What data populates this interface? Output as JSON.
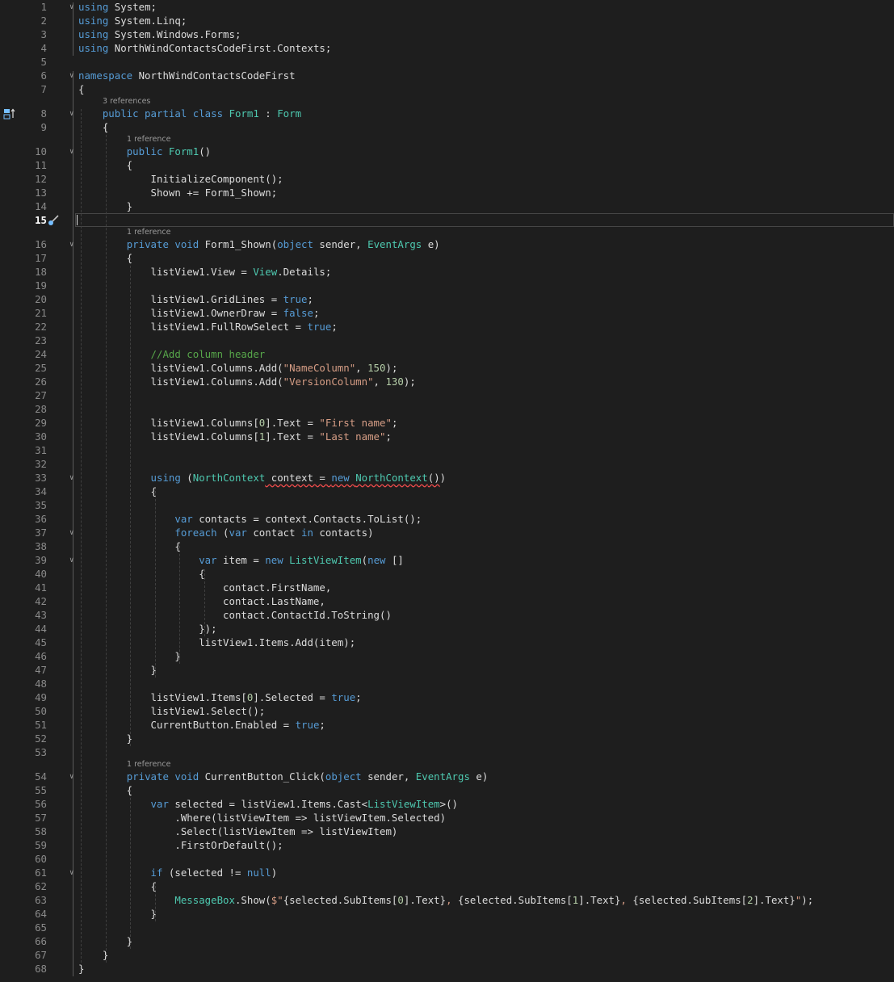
{
  "editor": {
    "lines": [
      {
        "n": "1",
        "toks": [
          [
            "kw",
            "using"
          ],
          [
            "pl",
            " System;"
          ]
        ]
      },
      {
        "n": "2",
        "toks": [
          [
            "kw",
            "using"
          ],
          [
            "pl",
            " System.Linq;"
          ]
        ]
      },
      {
        "n": "3",
        "toks": [
          [
            "kw",
            "using"
          ],
          [
            "pl",
            " System.Windows.Forms;"
          ]
        ]
      },
      {
        "n": "4",
        "toks": [
          [
            "kw",
            "using"
          ],
          [
            "pl",
            " NorthWindContactsCodeFirst.Contexts;"
          ]
        ]
      },
      {
        "n": "5",
        "toks": []
      },
      {
        "n": "6",
        "toks": [
          [
            "kw",
            "namespace"
          ],
          [
            "pl",
            " NorthWindContactsCodeFirst"
          ]
        ]
      },
      {
        "n": "7",
        "toks": [
          [
            "pl",
            "{"
          ]
        ]
      },
      {
        "n": "8",
        "toks": [
          [
            "pl",
            "    "
          ],
          [
            "kw",
            "public partial class "
          ],
          [
            "ty",
            "Form1"
          ],
          [
            "pl",
            " : "
          ],
          [
            "ty",
            "Form"
          ]
        ]
      },
      {
        "n": "9",
        "toks": [
          [
            "pl",
            "    {"
          ]
        ]
      },
      {
        "n": "10",
        "toks": [
          [
            "pl",
            "        "
          ],
          [
            "kw",
            "public "
          ],
          [
            "ty",
            "Form1"
          ],
          [
            "pl",
            "()"
          ]
        ]
      },
      {
        "n": "11",
        "toks": [
          [
            "pl",
            "        {"
          ]
        ]
      },
      {
        "n": "12",
        "toks": [
          [
            "pl",
            "            InitializeComponent();"
          ]
        ]
      },
      {
        "n": "13",
        "toks": [
          [
            "pl",
            "            Shown += Form1_Shown;"
          ]
        ]
      },
      {
        "n": "14",
        "toks": [
          [
            "pl",
            "        }"
          ]
        ]
      },
      {
        "n": "15",
        "toks": []
      },
      {
        "n": "16",
        "toks": [
          [
            "pl",
            "        "
          ],
          [
            "kw",
            "private void "
          ],
          [
            "pl",
            "Form1_Shown("
          ],
          [
            "kw",
            "object"
          ],
          [
            "pl",
            " sender, "
          ],
          [
            "ty",
            "EventArgs"
          ],
          [
            "pl",
            " e)"
          ]
        ]
      },
      {
        "n": "17",
        "toks": [
          [
            "pl",
            "        {"
          ]
        ]
      },
      {
        "n": "18",
        "toks": [
          [
            "pl",
            "            listView1.View = "
          ],
          [
            "ty",
            "View"
          ],
          [
            "pl",
            ".Details;"
          ]
        ]
      },
      {
        "n": "19",
        "toks": []
      },
      {
        "n": "20",
        "toks": [
          [
            "pl",
            "            listView1.GridLines = "
          ],
          [
            "kw",
            "true"
          ],
          [
            "pl",
            ";"
          ]
        ]
      },
      {
        "n": "21",
        "toks": [
          [
            "pl",
            "            listView1.OwnerDraw = "
          ],
          [
            "kw",
            "false"
          ],
          [
            "pl",
            ";"
          ]
        ]
      },
      {
        "n": "22",
        "toks": [
          [
            "pl",
            "            listView1.FullRowSelect = "
          ],
          [
            "kw",
            "true"
          ],
          [
            "pl",
            ";"
          ]
        ]
      },
      {
        "n": "23",
        "toks": []
      },
      {
        "n": "24",
        "toks": [
          [
            "pl",
            "            "
          ],
          [
            "cm",
            "//Add column header"
          ]
        ]
      },
      {
        "n": "25",
        "toks": [
          [
            "pl",
            "            listView1.Columns.Add("
          ],
          [
            "str",
            "\"NameColumn\""
          ],
          [
            "pl",
            ", "
          ],
          [
            "num",
            "150"
          ],
          [
            "pl",
            ");"
          ]
        ]
      },
      {
        "n": "26",
        "toks": [
          [
            "pl",
            "            listView1.Columns.Add("
          ],
          [
            "str",
            "\"VersionColumn\""
          ],
          [
            "pl",
            ", "
          ],
          [
            "num",
            "130"
          ],
          [
            "pl",
            ");"
          ]
        ]
      },
      {
        "n": "27",
        "toks": []
      },
      {
        "n": "28",
        "toks": []
      },
      {
        "n": "29",
        "toks": [
          [
            "pl",
            "            listView1.Columns["
          ],
          [
            "num",
            "0"
          ],
          [
            "pl",
            "].Text = "
          ],
          [
            "str",
            "\"First name\""
          ],
          [
            "pl",
            ";"
          ]
        ]
      },
      {
        "n": "30",
        "toks": [
          [
            "pl",
            "            listView1.Columns["
          ],
          [
            "num",
            "1"
          ],
          [
            "pl",
            "].Text = "
          ],
          [
            "str",
            "\"Last name\""
          ],
          [
            "pl",
            ";"
          ]
        ]
      },
      {
        "n": "31",
        "toks": []
      },
      {
        "n": "32",
        "toks": []
      },
      {
        "n": "33",
        "toks": [
          [
            "pl",
            "            "
          ],
          [
            "kw",
            "using"
          ],
          [
            "pl",
            " ("
          ],
          [
            "ty",
            "NorthContext"
          ],
          [
            "pl squig",
            " context = "
          ],
          [
            "kw squig",
            "new "
          ],
          [
            "ty squig",
            "NorthContext"
          ],
          [
            "pl squig",
            "()"
          ],
          [
            "pl",
            ")"
          ]
        ]
      },
      {
        "n": "34",
        "toks": [
          [
            "pl",
            "            {"
          ]
        ]
      },
      {
        "n": "35",
        "toks": []
      },
      {
        "n": "36",
        "toks": [
          [
            "pl",
            "                "
          ],
          [
            "kw",
            "var"
          ],
          [
            "pl",
            " contacts = context.Contacts.ToList();"
          ]
        ]
      },
      {
        "n": "37",
        "toks": [
          [
            "pl",
            "                "
          ],
          [
            "kw",
            "foreach"
          ],
          [
            "pl",
            " ("
          ],
          [
            "kw",
            "var"
          ],
          [
            "pl",
            " contact "
          ],
          [
            "kw",
            "in"
          ],
          [
            "pl",
            " contacts)"
          ]
        ]
      },
      {
        "n": "38",
        "toks": [
          [
            "pl",
            "                {"
          ]
        ]
      },
      {
        "n": "39",
        "toks": [
          [
            "pl",
            "                    "
          ],
          [
            "kw",
            "var"
          ],
          [
            "pl",
            " item = "
          ],
          [
            "kw",
            "new "
          ],
          [
            "ty",
            "ListViewItem"
          ],
          [
            "pl",
            "("
          ],
          [
            "kw",
            "new"
          ],
          [
            "pl",
            " []"
          ]
        ]
      },
      {
        "n": "40",
        "toks": [
          [
            "pl",
            "                    {"
          ]
        ]
      },
      {
        "n": "41",
        "toks": [
          [
            "pl",
            "                        contact.FirstName,"
          ]
        ]
      },
      {
        "n": "42",
        "toks": [
          [
            "pl",
            "                        contact.LastName,"
          ]
        ]
      },
      {
        "n": "43",
        "toks": [
          [
            "pl",
            "                        contact.ContactId.ToString()"
          ]
        ]
      },
      {
        "n": "44",
        "toks": [
          [
            "pl",
            "                    });"
          ]
        ]
      },
      {
        "n": "45",
        "toks": [
          [
            "pl",
            "                    listView1.Items.Add(item);"
          ]
        ]
      },
      {
        "n": "46",
        "toks": [
          [
            "pl",
            "                }"
          ]
        ]
      },
      {
        "n": "47",
        "toks": [
          [
            "pl",
            "            }"
          ]
        ]
      },
      {
        "n": "48",
        "toks": []
      },
      {
        "n": "49",
        "toks": [
          [
            "pl",
            "            listView1.Items["
          ],
          [
            "num",
            "0"
          ],
          [
            "pl",
            "].Selected = "
          ],
          [
            "kw",
            "true"
          ],
          [
            "pl",
            ";"
          ]
        ]
      },
      {
        "n": "50",
        "toks": [
          [
            "pl",
            "            listView1.Select();"
          ]
        ]
      },
      {
        "n": "51",
        "toks": [
          [
            "pl",
            "            CurrentButton.Enabled = "
          ],
          [
            "kw",
            "true"
          ],
          [
            "pl",
            ";"
          ]
        ]
      },
      {
        "n": "52",
        "toks": [
          [
            "pl",
            "        }"
          ]
        ]
      },
      {
        "n": "53",
        "toks": []
      },
      {
        "n": "54",
        "toks": [
          [
            "pl",
            "        "
          ],
          [
            "kw",
            "private void "
          ],
          [
            "pl",
            "CurrentButton_Click("
          ],
          [
            "kw",
            "object"
          ],
          [
            "pl",
            " sender, "
          ],
          [
            "ty",
            "EventArgs"
          ],
          [
            "pl",
            " e)"
          ]
        ]
      },
      {
        "n": "55",
        "toks": [
          [
            "pl",
            "        {"
          ]
        ]
      },
      {
        "n": "56",
        "toks": [
          [
            "pl",
            "            "
          ],
          [
            "kw",
            "var"
          ],
          [
            "pl",
            " selected = listView1.Items.Cast<"
          ],
          [
            "ty",
            "ListViewItem"
          ],
          [
            "pl",
            ">()"
          ]
        ]
      },
      {
        "n": "57",
        "toks": [
          [
            "pl",
            "                .Where(listViewItem => listViewItem.Selected)"
          ]
        ]
      },
      {
        "n": "58",
        "toks": [
          [
            "pl",
            "                .Select(listViewItem => listViewItem)"
          ]
        ]
      },
      {
        "n": "59",
        "toks": [
          [
            "pl",
            "                .FirstOrDefault();"
          ]
        ]
      },
      {
        "n": "60",
        "toks": []
      },
      {
        "n": "61",
        "toks": [
          [
            "pl",
            "            "
          ],
          [
            "kw",
            "if"
          ],
          [
            "pl",
            " (selected != "
          ],
          [
            "kw",
            "null"
          ],
          [
            "pl",
            ")"
          ]
        ]
      },
      {
        "n": "62",
        "toks": [
          [
            "pl",
            "            {"
          ]
        ]
      },
      {
        "n": "63",
        "toks": [
          [
            "pl",
            "                "
          ],
          [
            "ty",
            "MessageBox"
          ],
          [
            "pl",
            ".Show("
          ],
          [
            "str",
            "$\""
          ],
          [
            "pl",
            "{selected.SubItems["
          ],
          [
            "num",
            "0"
          ],
          [
            "pl",
            "].Text}"
          ],
          [
            "str",
            ", "
          ],
          [
            "pl",
            "{selected.SubItems["
          ],
          [
            "num",
            "1"
          ],
          [
            "pl",
            "].Text}"
          ],
          [
            "str",
            ", "
          ],
          [
            "pl",
            "{selected.SubItems["
          ],
          [
            "num",
            "2"
          ],
          [
            "pl",
            "].Text}"
          ],
          [
            "str",
            "\""
          ],
          [
            "pl",
            ");"
          ]
        ]
      },
      {
        "n": "64",
        "toks": [
          [
            "pl",
            "            }"
          ]
        ]
      },
      {
        "n": "65",
        "toks": []
      },
      {
        "n": "66",
        "toks": [
          [
            "pl",
            "        }"
          ]
        ]
      },
      {
        "n": "67",
        "toks": [
          [
            "pl",
            "    }"
          ]
        ]
      },
      {
        "n": "68",
        "toks": [
          [
            "pl",
            "}"
          ]
        ]
      }
    ],
    "current_line": "15",
    "code_lens": {
      "before_8": "3 references",
      "before_10": "1 reference",
      "before_16": "1 reference",
      "before_54": "1 reference"
    },
    "fold_lines": [
      "1",
      "6",
      "8",
      "10",
      "16",
      "33",
      "37",
      "39",
      "54",
      "61"
    ],
    "colors": {
      "background": "#1e1e1e",
      "keyword": "#569cd6",
      "type": "#4ec9b0",
      "string": "#d69d85",
      "number": "#b5cea8",
      "comment": "#57a64a",
      "text": "#dcdcdc",
      "line_number": "#8a8a8a"
    }
  }
}
